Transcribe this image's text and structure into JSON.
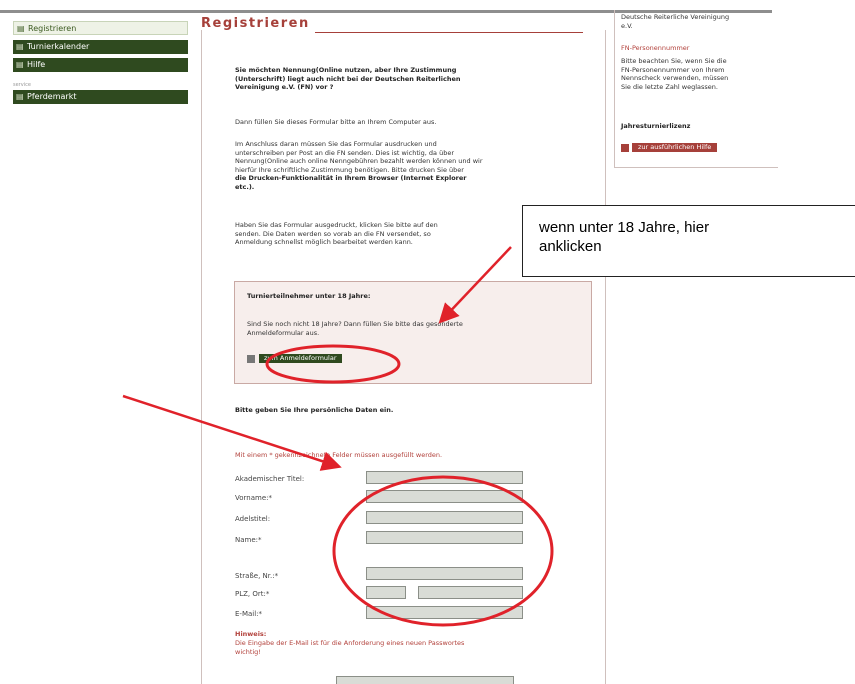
{
  "nav": {
    "items": [
      "Registrieren",
      "Turnierkalender",
      "Hilfe"
    ],
    "small_label": "service",
    "market": "Pferdemarkt"
  },
  "page": {
    "title": "Registrieren"
  },
  "sidebox": {
    "lines": [
      "Deutsche Reiterliche Vereinigung",
      "e.V."
    ],
    "fn_heading": "FN-Personennummer",
    "fn_text": [
      "Bitte beachten Sie, wenn Sie die",
      "FN-Personennummer von Ihrem",
      "Nennscheck verwenden, müssen",
      "Sie die letzte Zahl weglassen."
    ],
    "jahres_heading": "Jahresturnierlizenz",
    "jahres_button": "zur ausführlichen Hilfe"
  },
  "main": {
    "intro_bold": [
      "Sie möchten Nennung(Online nutzen, aber Ihre Zustimmung",
      "(Unterschrift) liegt auch nicht bei der Deutschen Reiterlichen",
      "Vereinigung e.V. (FN) vor ?"
    ],
    "p1": "Dann füllen Sie dieses Formular bitte an Ihrem Computer aus.",
    "p2": [
      "Im Anschluss daran müssen Sie das Formular ausdrucken und",
      "unterschreiben per Post an die FN senden. Dies ist wichtig, da über",
      "Nennung(Online auch online Nenngebühren bezahlt werden können und wir",
      "hierfür Ihre schriftliche Zustimmung benötigen. Bitte drucken Sie über",
      "die Drucken-Funktionalität in Ihrem Browser (Internet Explorer",
      "etc.)."
    ],
    "p3": [
      "Haben Sie das Formular ausgedruckt, klicken Sie bitte auf den",
      "senden. Die Daten werden so vorab an die FN versendet, so",
      "Anmeldung schnellst möglich bearbeitet werden kann."
    ],
    "under18_heading": "Turnierteilnehmer unter 18 Jahre:",
    "under18_text": [
      "Sind Sie noch nicht 18 Jahre? Dann füllen Sie bitte das gesonderte",
      "Anmeldeformular aus."
    ],
    "under18_button": "zum Anmeldeformular",
    "personal_heading": "Bitte geben Sie Ihre persönliche Daten ein.",
    "required_note": "Mit einem * gekennzeichnete Felder müssen ausgefüllt werden.",
    "labels": {
      "title": "Akademischer Titel:",
      "firstname": "Vorname:*",
      "adel": "Adelstitel:",
      "name": "Name:*",
      "street": "Straße, Nr.:*",
      "plz": "PLZ, Ort:*",
      "email": "E-Mail:*"
    },
    "hint_heading": "Hinweis:",
    "hint_text": [
      "Die Eingabe der E-Mail ist für die Anforderung eines neuen Passwortes",
      "wichtig!"
    ]
  },
  "callout": {
    "lines": [
      "wenn unter 18 Jahre, hier",
      "anklicken"
    ]
  }
}
